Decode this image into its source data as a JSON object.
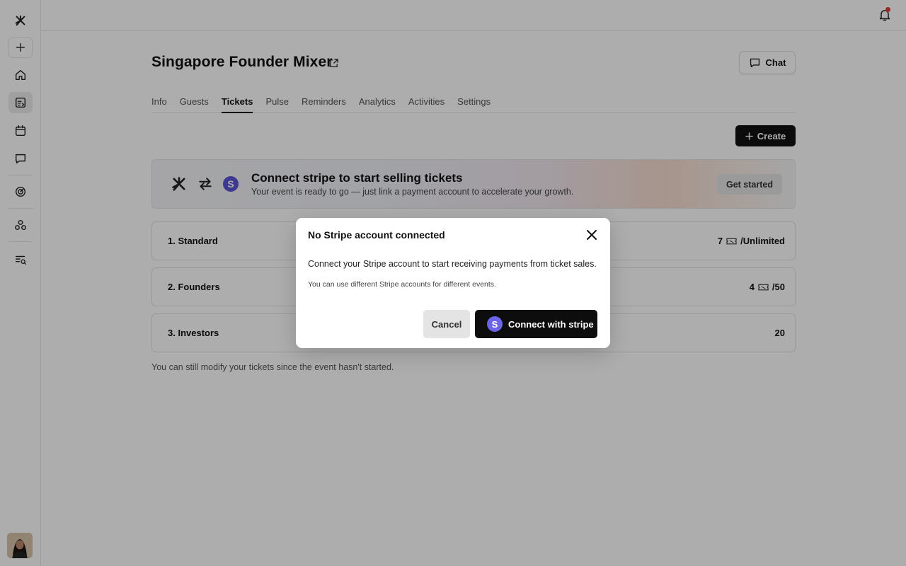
{
  "sidebar": {
    "items": [
      {
        "name": "logo-icon"
      },
      {
        "name": "add-icon"
      },
      {
        "name": "home-icon"
      },
      {
        "name": "events-icon"
      },
      {
        "name": "calendar-icon"
      },
      {
        "name": "messages-icon"
      },
      {
        "name": "analytics-icon"
      },
      {
        "name": "integrations-icon"
      },
      {
        "name": "search-list-icon"
      }
    ]
  },
  "header": {
    "event_title": "Singapore Founder Mixer",
    "chat_label": "Chat"
  },
  "tabs": [
    {
      "label": "Info",
      "active": false
    },
    {
      "label": "Guests",
      "active": false
    },
    {
      "label": "Tickets",
      "active": true
    },
    {
      "label": "Pulse",
      "active": false
    },
    {
      "label": "Reminders",
      "active": false
    },
    {
      "label": "Analytics",
      "active": false
    },
    {
      "label": "Activities",
      "active": false
    },
    {
      "label": "Settings",
      "active": false
    }
  ],
  "create_label": "Create",
  "banner": {
    "stripe_letter": "S",
    "title": "Connect stripe to start selling tickets",
    "subtitle": "Your event is ready to go — just link a payment account to accelerate your growth.",
    "button_label": "Get started"
  },
  "tickets": [
    {
      "name": "1.  Standard",
      "count": "7",
      "limit": "/Unlimited",
      "show_icon": true
    },
    {
      "name": "2.  Founders",
      "count": "4",
      "limit": "/50",
      "show_icon": true
    },
    {
      "name": "3.  Investors",
      "count": "20",
      "limit": "",
      "show_icon": false
    }
  ],
  "footnote": "You can still modify your tickets since the event hasn't started.",
  "modal": {
    "title": "No Stripe account connected",
    "body": "Connect your Stripe account to start receiving payments from ticket sales.",
    "note": "You can use different Stripe accounts for different events.",
    "cancel_label": "Cancel",
    "connect_label": "Connect with stripe",
    "stripe_letter": "S"
  },
  "colors": {
    "stripe_purple": "#5b55d6",
    "primary_button": "#111111",
    "notification_dot": "#e53935"
  }
}
